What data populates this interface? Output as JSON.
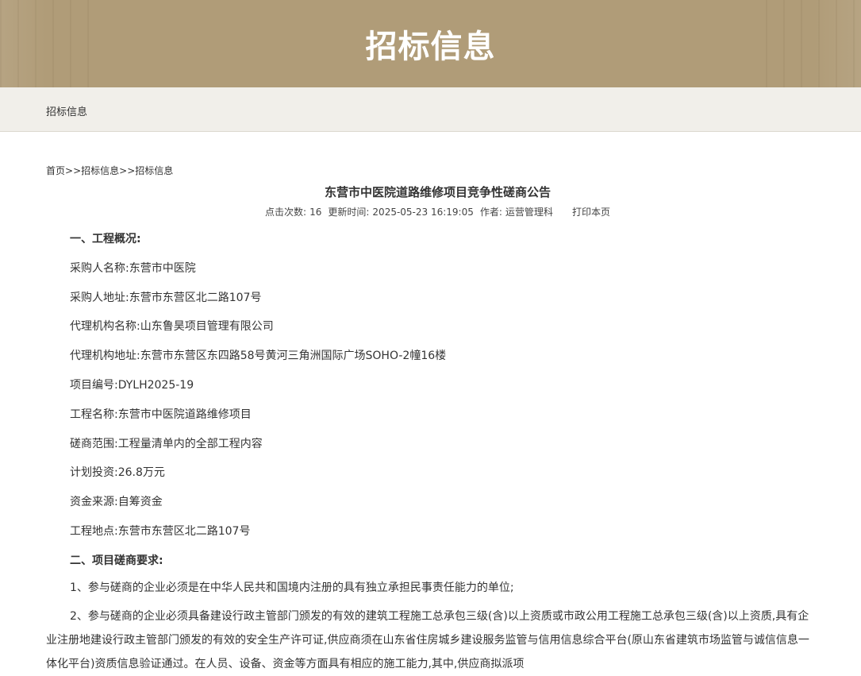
{
  "banner": {
    "title": "招标信息"
  },
  "subbar": {
    "label": "招标信息"
  },
  "breadcrumb": {
    "home": "首页",
    "sep1": ">>",
    "level1": "招标信息",
    "sep2": ">>",
    "level2": "招标信息"
  },
  "article": {
    "title": "东营市中医院道路维修项目竞争性磋商公告",
    "meta": {
      "clicks_label": "点击次数:",
      "clicks_value": "16",
      "updated_label": "更新时间:",
      "updated_value": "2025-05-23 16:19:05",
      "author_label": "作者:",
      "author_value": "运营管理科",
      "print_link": "打印本页"
    },
    "section1_heading": "一、工程概况:",
    "lines": [
      "采购人名称:东营市中医院",
      "采购人地址:东营市东营区北二路107号",
      "代理机构名称:山东鲁昊项目管理有限公司",
      "代理机构地址:东营市东营区东四路58号黄河三角洲国际广场SOHO-2幢16楼",
      "项目编号:DYLH2025-19",
      "工程名称:东营市中医院道路维修项目",
      "磋商范围:工程量清单内的全部工程内容",
      "计划投资:26.8万元",
      "资金来源:自筹资金",
      "工程地点:东营市东营区北二路107号"
    ],
    "section2_heading": "二、项目磋商要求:",
    "req1": "1、参与磋商的企业必须是在中华人民共和国境内注册的具有独立承担民事责任能力的单位;",
    "req2": "2、参与磋商的企业必须具备建设行政主管部门颁发的有效的建筑工程施工总承包三级(含)以上资质或市政公用工程施工总承包三级(含)以上资质,具有企业注册地建设行政主管部门颁发的有效的安全生产许可证,供应商须在山东省住房城乡建设服务监管与信用信息综合平台(原山东省建筑市场监管与诚信信息一体化平台)资质信息验证通过。在人员、设备、资金等方面具有相应的施工能力,其中,供应商拟派项"
  }
}
